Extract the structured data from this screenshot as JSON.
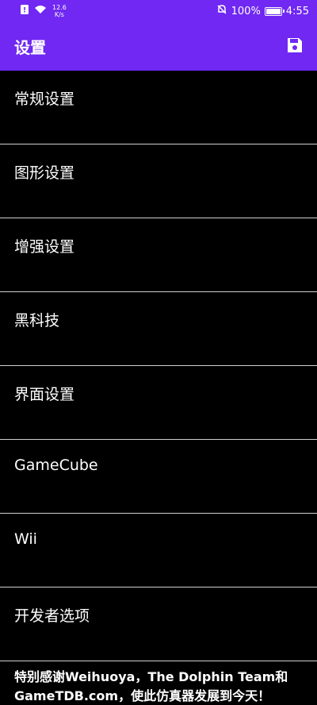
{
  "status_bar": {
    "speed_value": "12.6",
    "speed_unit": "K/s",
    "battery_percent": "100%",
    "time": "4:55"
  },
  "app_bar": {
    "title": "设置",
    "save_icon": "save-icon"
  },
  "settings": {
    "items": [
      {
        "label": "常规设置"
      },
      {
        "label": "图形设置"
      },
      {
        "label": "增强设置"
      },
      {
        "label": "黑科技"
      },
      {
        "label": "界面设置"
      },
      {
        "label": "GameCube"
      },
      {
        "label": "Wii"
      },
      {
        "label": "开发者选项"
      }
    ]
  },
  "footer": {
    "text": "特别感谢Weihuoya，The Dolphin Team和GameTDB.com，使此仿真器发展到今天！"
  },
  "colors": {
    "accent": "#7028f2",
    "background": "#000000",
    "divider": "#cfcfcf"
  }
}
